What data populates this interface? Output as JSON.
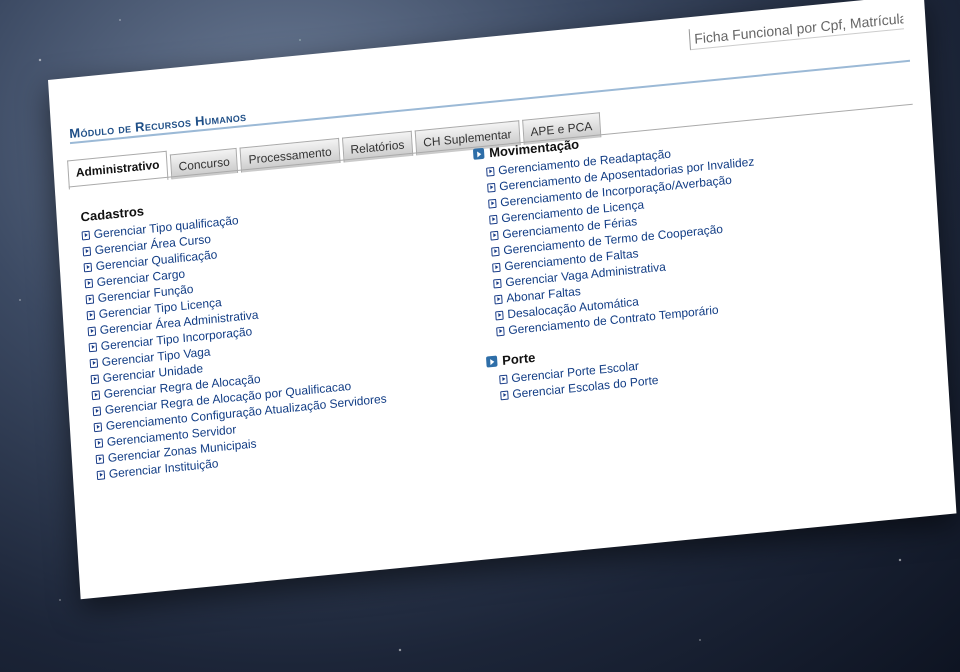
{
  "search": {
    "placeholder": "Ficha Funcional por Cpf, Matrícula"
  },
  "module": {
    "title": "Módulo de Recursos Humanos"
  },
  "tabs": [
    {
      "label": "Administrativo",
      "active": true
    },
    {
      "label": "Concurso"
    },
    {
      "label": "Processamento"
    },
    {
      "label": "Relatórios"
    },
    {
      "label": "CH Suplementar"
    },
    {
      "label": "APE e PCA"
    }
  ],
  "cadastros": {
    "title": "Cadastros",
    "items": [
      "Gerenciar Tipo qualificação",
      "Gerenciar Área Curso",
      "Gerenciar Qualificação",
      "Gerenciar Cargo",
      "Gerenciar Função",
      "Gerenciar Tipo Licença",
      "Gerenciar Área Administrativa",
      "Gerenciar Tipo Incorporação",
      "Gerenciar Tipo Vaga",
      "Gerenciar Unidade",
      "Gerenciar Regra de Alocação",
      "Gerenciar Regra de Alocação por Qualificacao",
      "Gerenciamento Configuração Atualização Servidores",
      "Gerenciamento Servidor",
      "Gerenciar Zonas Municipais",
      "Gerenciar Instituição"
    ]
  },
  "movimentacao": {
    "title": "Movimentação",
    "items": [
      "Gerenciamento de Readaptação",
      "Gerenciamento de Aposentadorias por Invalidez",
      "Gerenciamento de Incorporação/Averbação",
      "Gerenciamento de Licença",
      "Gerenciamento de Férias",
      "Gerenciamento de Termo de Cooperação",
      "Gerenciamento de Faltas",
      "Gerenciar Vaga Administrativa",
      "Abonar Faltas",
      "Desalocação Automática",
      "Gerenciamento de Contrato Temporário"
    ]
  },
  "porte": {
    "title": "Porte",
    "items": [
      "Gerenciar Porte Escolar",
      "Gerenciar Escolas do Porte"
    ]
  },
  "colors": {
    "link": "#123d85",
    "title": "#1f4f87",
    "bullet": "#2e6ea8"
  }
}
